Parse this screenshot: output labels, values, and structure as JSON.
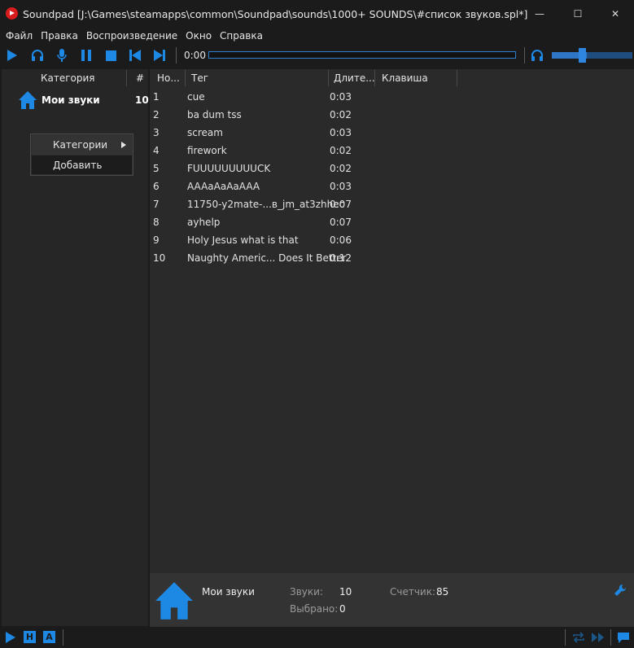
{
  "window": {
    "title": "Soundpad [J:\\Games\\steamapps\\common\\Soundpad\\sounds\\1000+ SOUNDS\\#список звуков.spl*]",
    "controls": {
      "minimize": "—",
      "maximize": "☐",
      "close": "✕"
    }
  },
  "menu": [
    "Файл",
    "Правка",
    "Воспроизведение",
    "Окно",
    "Справка"
  ],
  "toolbar": {
    "time": "0:00",
    "icons": [
      "play-icon",
      "headphones-icon",
      "microphone-icon",
      "pause-icon",
      "stop-icon",
      "previous-icon",
      "next-icon",
      "headphones-volume-icon"
    ],
    "volume_level": 0.4,
    "progress": 0
  },
  "categories": {
    "header_label": "Категория",
    "header_count": "#",
    "items": [
      {
        "label": "Мои звуки",
        "count": "10"
      }
    ]
  },
  "context_menu": {
    "item1": "Категории",
    "item2": "Добавить"
  },
  "sound_table": {
    "columns": {
      "num": "Но...",
      "tag": "Тег",
      "duration": "Длите...",
      "hotkey": "Клавиша"
    },
    "rows": [
      {
        "num": "1",
        "tag": "cue",
        "duration": "0:03"
      },
      {
        "num": "2",
        "tag": "ba dum tss",
        "duration": "0:02"
      },
      {
        "num": "3",
        "tag": "scream",
        "duration": "0:03"
      },
      {
        "num": "4",
        "tag": "firework",
        "duration": "0:02"
      },
      {
        "num": "5",
        "tag": "FUUUUUUUUUCK",
        "duration": "0:02"
      },
      {
        "num": "6",
        "tag": "AAAaAaAaAAA",
        "duration": "0:03"
      },
      {
        "num": "7",
        "tag": "11750-y2mate-...в_jm_at3zhhec",
        "duration": "0:07"
      },
      {
        "num": "8",
        "tag": "ayhelp",
        "duration": "0:07"
      },
      {
        "num": "9",
        "tag": "Holy Jesus what is that",
        "duration": "0:06"
      },
      {
        "num": "10",
        "tag": "Naughty Americ... Does It Better",
        "duration": "0:12"
      }
    ]
  },
  "footer": {
    "category_name": "Мои звуки",
    "sounds_label": "Звуки:",
    "sounds_value": "10",
    "selected_label": "Выбрано:",
    "selected_value": "0",
    "counter_label": "Счетчик:",
    "counter_value": "85"
  },
  "statusbar": {
    "h_label": "H",
    "a_label": "A"
  },
  "colors": {
    "accent": "#1e88e5",
    "background": "#1b1b1b",
    "panel": "#2a2a2a"
  }
}
